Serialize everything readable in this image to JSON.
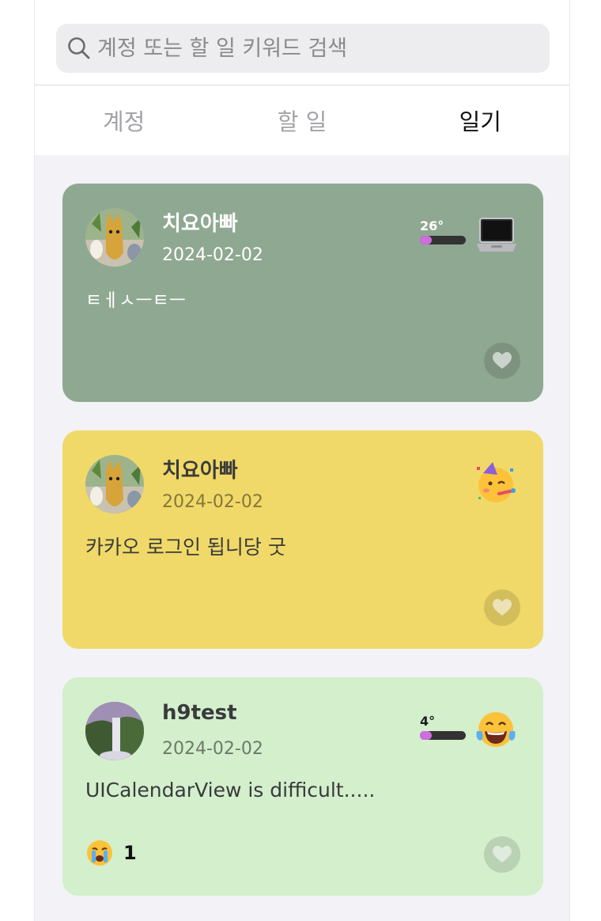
{
  "search": {
    "placeholder": "계정 또는 할 일 키워드 검색"
  },
  "tabs": [
    {
      "label": "계정",
      "active": false
    },
    {
      "label": "할 일",
      "active": false
    },
    {
      "label": "일기",
      "active": true
    }
  ],
  "entries": [
    {
      "author": "치요아빠",
      "date": "2024-02-02",
      "content": "ㅌㅔㅅㅡㅌㅡ",
      "temperature": "26°",
      "temperature_level": 0.25,
      "mood_icon": "laptop-icon",
      "background": "#8fa892",
      "liked": false
    },
    {
      "author": "치요아빠",
      "date": "2024-02-02",
      "content": "카카오 로그인 됩니당 굿",
      "mood_icon": "party-face-icon",
      "background": "#f0d968",
      "liked": false
    },
    {
      "author": "h9test",
      "date": "2024-02-02",
      "content": "UICalendarView is difficult.....",
      "temperature": "4°",
      "temperature_level": 0.25,
      "mood_icon": "tears-of-joy-icon",
      "background": "#d3efcc",
      "liked": false,
      "reaction": {
        "icon": "crying-face-icon",
        "count": "1"
      }
    }
  ]
}
